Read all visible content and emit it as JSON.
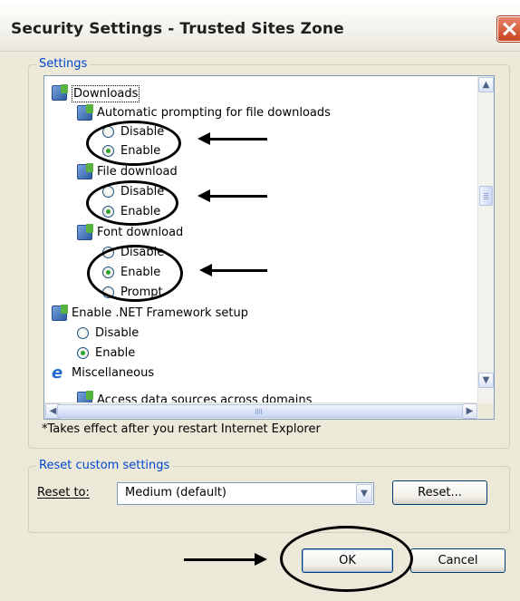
{
  "window": {
    "title": "Security Settings - Trusted Sites Zone"
  },
  "settings_group": {
    "legend": "Settings"
  },
  "tree": {
    "downloads": "Downloads",
    "auto_prompt": "Automatic prompting for file downloads",
    "auto_prompt_options": [
      "Disable",
      "Enable"
    ],
    "file_download": "File download",
    "file_download_options": [
      "Disable",
      "Enable"
    ],
    "font_download": "Font download",
    "font_download_options": [
      "Disable",
      "Enable",
      "Prompt"
    ],
    "net_framework": "Enable .NET Framework setup",
    "net_framework_options": [
      "Disable",
      "Enable"
    ],
    "misc": "Miscellaneous",
    "access_data": "Access data sources across domains"
  },
  "selected": {
    "auto_prompt": "Enable",
    "file_download": "Enable",
    "font_download": "Enable",
    "net_framework": "Enable"
  },
  "note": "*Takes effect after you restart Internet Explorer",
  "reset_group": {
    "legend": "Reset custom settings",
    "reset_to_label": "Reset to:",
    "selected_level": "Medium (default)",
    "reset_button": "Reset..."
  },
  "buttons": {
    "ok": "OK",
    "cancel": "Cancel"
  },
  "icons": {
    "close": "close-icon",
    "category": "settings-category-icon",
    "misc": "internet-explorer-icon"
  }
}
